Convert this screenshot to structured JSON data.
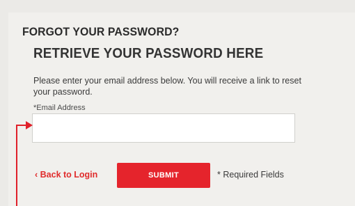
{
  "page": {
    "section_title": "FORGOT YOUR PASSWORD?",
    "sub_title": "RETRIEVE YOUR PASSWORD HERE",
    "instructions": "Please enter your email address below. You will receive a link to reset your password."
  },
  "form": {
    "email_label": "*Email Address",
    "email_value": "",
    "back_link": "‹ Back to Login",
    "submit_label": "SUBMIT",
    "required_note": "* Required Fields"
  },
  "colors": {
    "accent": "#e5242c",
    "background": "#ebeae7",
    "panel": "#f1f0ed",
    "text": "#333333"
  },
  "annotation": {
    "arrow_icon": "pointer-arrow-icon"
  }
}
